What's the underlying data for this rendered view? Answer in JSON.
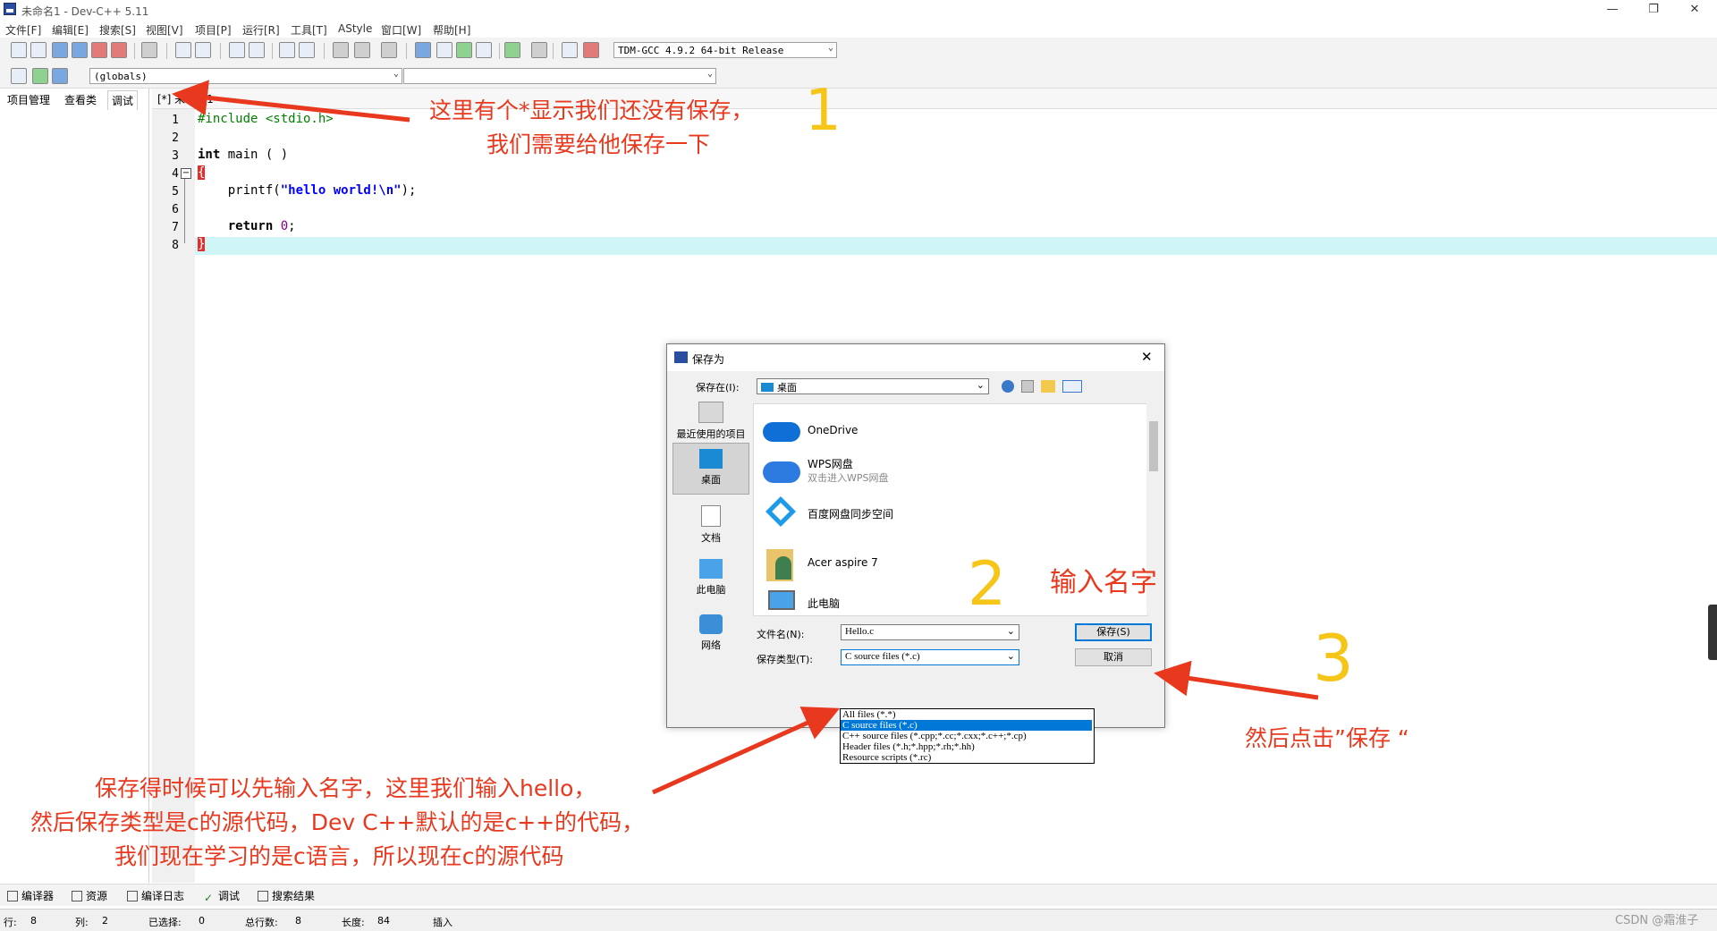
{
  "window": {
    "title": "未命名1 - Dev-C++ 5.11",
    "minimize": "—",
    "maximize": "❐",
    "close": "✕"
  },
  "menu": [
    "文件[F]",
    "编辑[E]",
    "搜索[S]",
    "视图[V]",
    "项目[P]",
    "运行[R]",
    "工具[T]",
    "AStyle",
    "窗口[W]",
    "帮助[H]"
  ],
  "toolbar": {
    "compiler_select": "TDM-GCC 4.9.2 64-bit Release",
    "scope_select": "(globals)",
    "symbol_select": ""
  },
  "left_panel": {
    "tabs": [
      "项目管理",
      "查看类",
      "调试"
    ]
  },
  "editor": {
    "tab_label": "[*] 未命名1",
    "line_numbers": [
      "1",
      "2",
      "3",
      "4",
      "5",
      "6",
      "7",
      "8"
    ],
    "code": {
      "line1": "#include <stdio.h>",
      "line3_kw": "int",
      "line3_rest": " main ( )",
      "line4": "{",
      "line5_a": "    printf(",
      "line5_str": "\"hello world!\\n\"",
      "line5_b": ");",
      "line7_kw": "    return",
      "line7_num": " 0",
      "line7_end": ";",
      "line8": "}"
    }
  },
  "dialog": {
    "title": "保存为",
    "save_in_label": "保存在(I):",
    "save_in_value": "桌面",
    "places": [
      "最近使用的项目",
      "桌面",
      "文档",
      "此电脑",
      "网络"
    ],
    "files": [
      {
        "name": "OneDrive",
        "sub": ""
      },
      {
        "name": "WPS网盘",
        "sub": "双击进入WPS网盘"
      },
      {
        "name": "百度网盘同步空间",
        "sub": ""
      },
      {
        "name": "Acer aspire 7",
        "sub": ""
      },
      {
        "name": "此电脑",
        "sub": ""
      }
    ],
    "filename_label": "文件名(N):",
    "filename_value": "Hello.c",
    "filetype_label": "保存类型(T):",
    "filetype_value": "C source files (*.c)",
    "save_button": "保存(S)",
    "cancel_button": "取消",
    "type_options": [
      "All files (*.*)",
      "C source files (*.c)",
      "C++ source files (*.cpp;*.cc;*.cxx;*.c++;*.cp)",
      "Header files (*.h;*.hpp;*.rh;*.hh)",
      "Resource scripts (*.rc)"
    ]
  },
  "bottom_tabs": [
    "编译器",
    "资源",
    "编译日志",
    "调试",
    "搜索结果"
  ],
  "status": {
    "row_label": "行:",
    "row": "8",
    "col_label": "列:",
    "col": "2",
    "sel_label": "已选择:",
    "sel": "0",
    "lines_label": "总行数:",
    "lines": "8",
    "len_label": "长度:",
    "len": "84",
    "mode": "插入"
  },
  "annotations": {
    "note1_line1": "这里有个*显示我们还没有保存，",
    "note1_line2": "我们需要给他保存一下",
    "num1": "1",
    "num2": "2",
    "num3": "3",
    "note2": "输入名字",
    "note3": "然后点击”保存 “",
    "note4_line1": "保存得时候可以先输入名字，这里我们输入hello，",
    "note4_line2": "然后保存类型是c的源代码，Dev C++默认的是c++的代码，",
    "note4_line3": "我们现在学习的是c语言，所以现在c的源代码",
    "arrow_color": "#e8391f",
    "circle_color": "#f5c518"
  },
  "watermark": "CSDN @霜淮子"
}
